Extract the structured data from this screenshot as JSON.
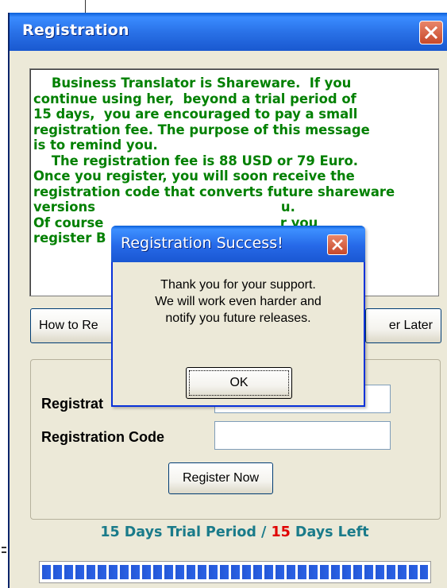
{
  "window": {
    "title": "Registration"
  },
  "message": {
    "lines": [
      "    Business Translator is Shareware.  If you",
      "continue using her,  beyond a trial period of",
      "15 days,  you are encouraged to pay a small",
      "registration fee. The purpose of this message",
      "is to remind you.",
      "    The registration fee is 88 USD or 79 Euro.",
      "Once you register, you will soon receive the",
      "registration code that converts future shareware",
      "versions                                         u.",
      "Of course                                       r you",
      "register B"
    ]
  },
  "buttons": {
    "how_to_register": "How to Re",
    "register_later": "er Later",
    "register_now": "Register Now"
  },
  "form": {
    "name_label": "Registrat",
    "code_label": "Registration Code",
    "name_value": "",
    "code_value": ""
  },
  "status": {
    "trial_prefix": "15 Days Trial Period / ",
    "days_left": "15",
    "suffix": " Days Left"
  },
  "progress": {
    "fraction": 1.0
  },
  "dialog": {
    "title": "Registration Success!",
    "message_lines": [
      "Thank you for your support.",
      "We will work even harder and",
      "notify you future releases."
    ],
    "ok_label": "OK"
  },
  "colors": {
    "message_text": "#008000",
    "status_teal": "#1a7b8a",
    "status_red": "#e00000",
    "titlebar_blue": "#2a72e8",
    "window_bg": "#ece9d8"
  },
  "icons": {
    "title_close": "close-icon",
    "dialog_close": "close-icon"
  }
}
